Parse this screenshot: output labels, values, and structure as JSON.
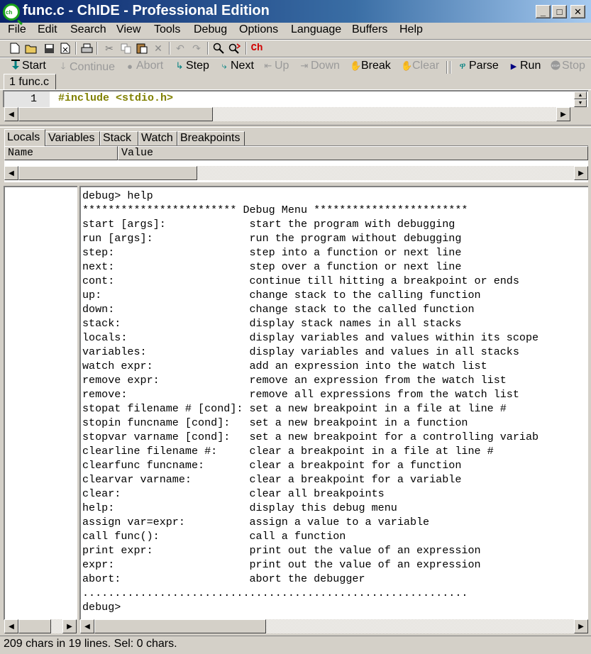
{
  "window": {
    "title": "func.c - ChIDE - Professional Edition",
    "app_icon_text": "ch",
    "minimize": "_",
    "maximize": "□",
    "close": "✕"
  },
  "menu": [
    "File",
    "Edit",
    "Search",
    "View",
    "Tools",
    "Debug",
    "Options",
    "Language",
    "Buffers",
    "Help"
  ],
  "toolbar1": {
    "icons": [
      "new-file-icon",
      "open-folder-icon",
      "save-icon",
      "close-file-icon",
      "print-icon",
      "cut-icon",
      "copy-icon",
      "paste-icon",
      "delete-icon",
      "undo-icon",
      "redo-icon",
      "find-icon",
      "replace-icon",
      "ch-icon"
    ],
    "ch_label": "Ch"
  },
  "toolbar2": {
    "start": "Start",
    "continue": "Continue",
    "abort": "Abort",
    "step": "Step",
    "next": "Next",
    "up": "Up",
    "down": "Down",
    "break": "Break",
    "clear": "Clear",
    "parse": "Parse",
    "run": "Run",
    "stop": "Stop"
  },
  "doc_tab": "1 func.c",
  "editor": {
    "line_number": "1",
    "code": "#include <stdio.h>"
  },
  "debug_tabs": [
    "Locals",
    "Variables",
    "Stack",
    "Watch",
    "Breakpoints"
  ],
  "locals_columns": [
    "Name",
    "Value"
  ],
  "output_lines": [
    "debug> help",
    "************************ Debug Menu ************************",
    "start [args]:             start the program with debugging",
    "run [args]:               run the program without debugging",
    "step:                     step into a function or next line",
    "next:                     step over a function or next line",
    "cont:                     continue till hitting a breakpoint or ends",
    "up:                       change stack to the calling function",
    "down:                     change stack to the called function",
    "stack:                    display stack names in all stacks",
    "locals:                   display variables and values within its scope",
    "variables:                display variables and values in all stacks",
    "watch expr:               add an expression into the watch list",
    "remove expr:              remove an expression from the watch list",
    "remove:                   remove all expressions from the watch list",
    "stopat filename # [cond]: set a new breakpoint in a file at line #",
    "stopin funcname [cond]:   set a new breakpoint in a function",
    "stopvar varname [cond]:   set a new breakpoint for a controlling variab",
    "clearline filename #:     clear a breakpoint in a file at line #",
    "clearfunc funcname:       clear a breakpoint for a function",
    "clearvar varname:         clear a breakpoint for a variable",
    "clear:                    clear all breakpoints",
    "help:                     display this debug menu",
    "assign var=expr:          assign a value to a variable",
    "call func():              call a function",
    "print expr:               print out the value of an expression",
    "expr:                     print out the value of an expression",
    "abort:                    abort the debugger",
    "............................................................",
    "debug>"
  ],
  "status": "209 chars in 19 lines. Sel: 0 chars."
}
